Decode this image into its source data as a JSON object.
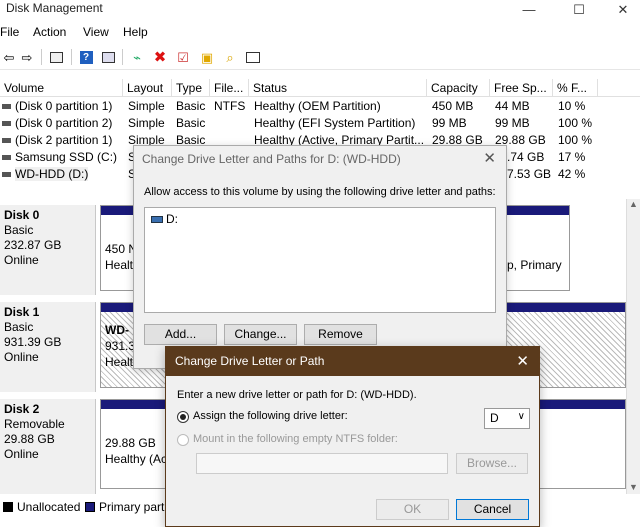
{
  "window": {
    "title": "Disk Management",
    "min": "—",
    "max": "☐",
    "close": "✕"
  },
  "menu": [
    "File",
    "Action",
    "View",
    "Help"
  ],
  "toolbar_icons": [
    "back-icon",
    "forward-icon",
    "console-icon",
    "help-icon",
    "properties-icon",
    "connect-icon",
    "delete-icon",
    "check-icon",
    "upload-icon",
    "search-icon",
    "list-icon"
  ],
  "columns": [
    "Volume",
    "Layout",
    "Type",
    "File...",
    "Status",
    "Capacity",
    "Free Sp...",
    "% F..."
  ],
  "volumes": [
    {
      "name": "(Disk 0 partition 1)",
      "layout": "Simple",
      "type": "Basic",
      "fs": "NTFS",
      "status": "Healthy (OEM Partition)",
      "capacity": "450 MB",
      "free": "44 MB",
      "pct": "10 %"
    },
    {
      "name": "(Disk 0 partition 2)",
      "layout": "Simple",
      "type": "Basic",
      "fs": "",
      "status": "Healthy (EFI System Partition)",
      "capacity": "99 MB",
      "free": "99 MB",
      "pct": "100 %"
    },
    {
      "name": "(Disk 2 partition 1)",
      "layout": "Simple",
      "type": "Basic",
      "fs": "",
      "status": "Healthy (Active, Primary Partit...",
      "capacity": "29.88 GB",
      "free": "29.88 GB",
      "pct": "100 %"
    },
    {
      "name": "Samsung SSD (C:)",
      "layout": "S",
      "type": "",
      "fs": "",
      "status": "",
      "capacity": "",
      "free": ".74 GB",
      "pct": "17 %"
    },
    {
      "name": "WD-HDD (D:)",
      "layout": "S",
      "type": "",
      "fs": "",
      "status": "",
      "capacity": "",
      "free": "7.53 GB",
      "pct": "42 %"
    }
  ],
  "disks": [
    {
      "name": "Disk 0",
      "type": "Basic",
      "size": "232.87 GB",
      "state": "Online",
      "part_size": "450 N",
      "part_status": "Healt",
      "right_text": "mp, Primary"
    },
    {
      "name": "Disk 1",
      "type": "Basic",
      "size": "931.39 GB",
      "state": "Online",
      "part_size": "WD-",
      "part_sub": "931.3",
      "part_status": "Healt"
    },
    {
      "name": "Disk 2",
      "type": "Removable",
      "size": "29.88 GB",
      "state": "Online",
      "part_size": "29.88 GB",
      "part_status": "Healthy (Ac"
    }
  ],
  "legend": {
    "unallocated": "Unallocated",
    "primary": "Primary parti"
  },
  "dialog1": {
    "title": "Change Drive Letter and Paths for D: (WD-HDD)",
    "instruction": "Allow access to this volume by using the following drive letter and paths:",
    "item": "D:",
    "add": "Add...",
    "change": "Change...",
    "remove": "Remove"
  },
  "dialog2": {
    "title": "Change Drive Letter or Path",
    "instruction": "Enter a new drive letter or path for D: (WD-HDD).",
    "assign_label": "Assign the following drive letter:",
    "letter": "D",
    "mount_label": "Mount in the following empty NTFS folder:",
    "browse": "Browse...",
    "ok": "OK",
    "cancel": "Cancel"
  }
}
